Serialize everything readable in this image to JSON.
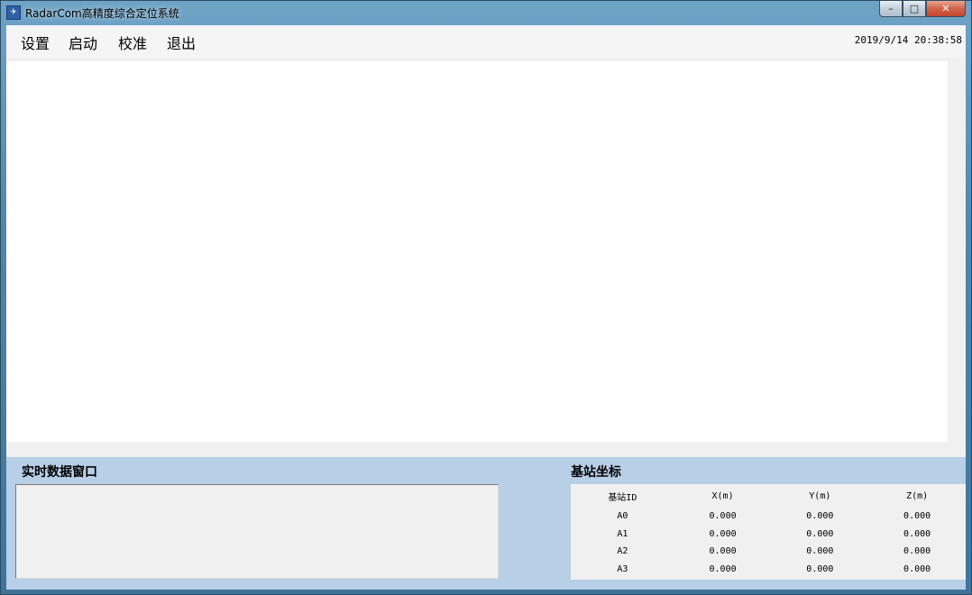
{
  "window": {
    "title": "RadarCom高精度综合定位系统",
    "app_icon": "radar-app-icon",
    "controls": {
      "minimize": "–",
      "maximize": "□",
      "close": "✕"
    }
  },
  "menu": {
    "items": [
      {
        "label": "设置"
      },
      {
        "label": "启动"
      },
      {
        "label": "校准"
      },
      {
        "label": "退出"
      }
    ],
    "datetime": "2019/9/14 20:38:58"
  },
  "realtime_panel": {
    "title": "实时数据窗口",
    "content": ""
  },
  "station_panel": {
    "title": "基站坐标",
    "columns": [
      "基站ID",
      "X(m)",
      "Y(m)",
      "Z(m)"
    ],
    "rows": [
      [
        "A0",
        "0.000",
        "0.000",
        "0.000"
      ],
      [
        "A1",
        "0.000",
        "0.000",
        "0.000"
      ],
      [
        "A2",
        "0.000",
        "0.000",
        "0.000"
      ],
      [
        "A3",
        "0.000",
        "0.000",
        "0.000"
      ]
    ]
  },
  "colors": {
    "bottom_panel_bg": "#b8cfe8",
    "client_bg": "#f0f0f0",
    "canvas_bg": "#ffffff"
  }
}
